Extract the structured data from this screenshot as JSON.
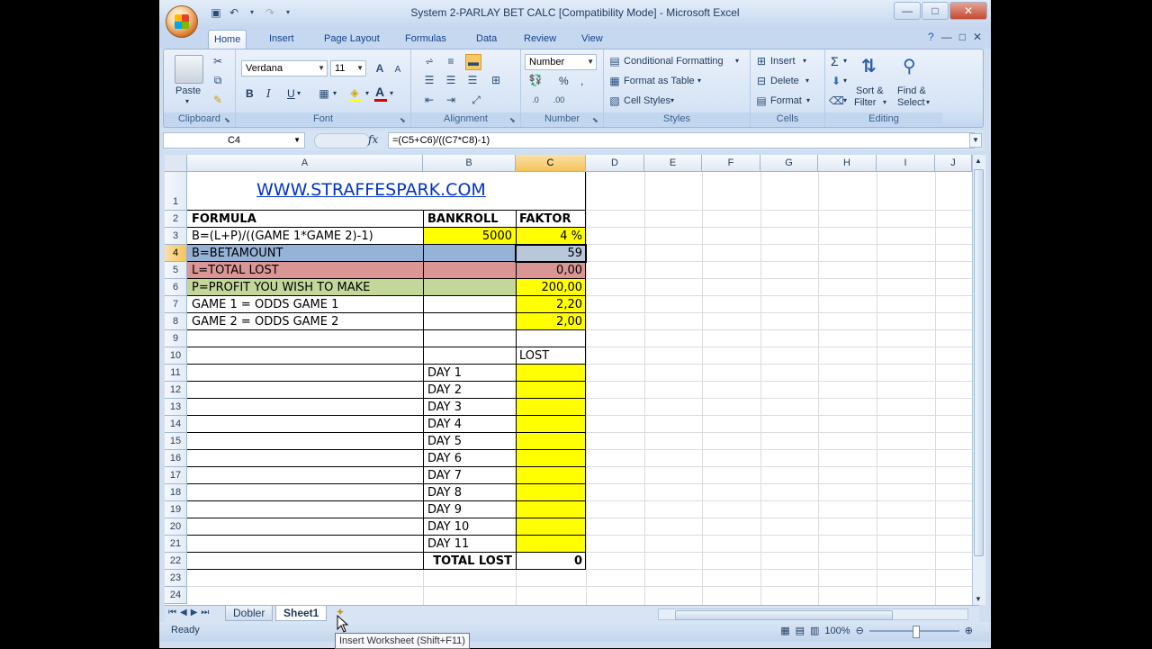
{
  "window": {
    "title": "System 2-PARLAY BET CALC  [Compatibility Mode] - Microsoft Excel",
    "controls": [
      "—",
      "□",
      "✕"
    ]
  },
  "qat": {
    "save_icon": "save-icon",
    "undo_icon": "undo-icon",
    "redo_icon": "redo-icon"
  },
  "tabs": [
    "Home",
    "Insert",
    "Page Layout",
    "Formulas",
    "Data",
    "Review",
    "View"
  ],
  "ribbon": {
    "clipboard": {
      "paste": "Paste",
      "label": "Clipboard"
    },
    "font": {
      "name": "Verdana",
      "size": "11",
      "label": "Font",
      "bold": "B",
      "italic": "I",
      "underline": "U"
    },
    "alignment": {
      "label": "Alignment"
    },
    "number": {
      "format": "Number",
      "label": "Number",
      "percent": "%"
    },
    "styles": {
      "conditional": "Conditional Formatting",
      "format_table": "Format as Table",
      "cell_styles": "Cell Styles",
      "label": "Styles"
    },
    "cells": {
      "insert": "Insert",
      "delete": "Delete",
      "format": "Format",
      "label": "Cells"
    },
    "editing": {
      "sort_line1": "Sort &",
      "sort_line2": "Filter",
      "find_line1": "Find &",
      "find_line2": "Select",
      "label": "Editing"
    }
  },
  "formula_bar": {
    "name_box": "C4",
    "fx": "fx",
    "formula": "=(C5+C6)/((C7*C8)-1)"
  },
  "columns": [
    "A",
    "B",
    "C",
    "D",
    "E",
    "F",
    "G",
    "H",
    "I",
    "J"
  ],
  "rows": [
    "1",
    "2",
    "3",
    "4",
    "5",
    "6",
    "7",
    "8",
    "9",
    "10",
    "11",
    "12",
    "13",
    "14",
    "15",
    "16",
    "17",
    "18",
    "19",
    "20",
    "21",
    "22",
    "23",
    "24"
  ],
  "cells": {
    "url": "WWW.STRAFFESPARK.COM",
    "a2": "FORMULA",
    "b2": "BANKROLL",
    "c2": "FAKTOR",
    "a3": "B=(L+P)/((GAME 1*GAME 2)-1)",
    "b3": "5000",
    "c3": "4 %",
    "a4": "B=BETAMOUNT",
    "c4": "59",
    "a5": "L=TOTAL LOST",
    "c5": "0,00",
    "a6": "P=PROFIT YOU WISH TO MAKE",
    "c6": "200,00",
    "a7": "GAME 1 = ODDS GAME 1",
    "c7": "2,20",
    "a8": "GAME 2 = ODDS GAME 2",
    "c8": "2,00",
    "c10": "LOST",
    "days": [
      "DAY 1",
      "DAY 2",
      "DAY 3",
      "DAY 4",
      "DAY 5",
      "DAY 6",
      "DAY 7",
      "DAY 8",
      "DAY 9",
      "DAY 10",
      "DAY 11"
    ],
    "b22": "TOTAL LOST",
    "c22": "0"
  },
  "sheet_tabs": [
    "Dobler",
    "Sheet1"
  ],
  "status": {
    "ready": "Ready",
    "zoom": "100%"
  },
  "tooltip": "Insert Worksheet (Shift+F11)",
  "colors": {
    "yellow": "#ffff00",
    "blue_fill": "#95b3d7",
    "red_fill": "#da9694",
    "green_fill": "#c4d79b",
    "link": "#0033cc"
  }
}
